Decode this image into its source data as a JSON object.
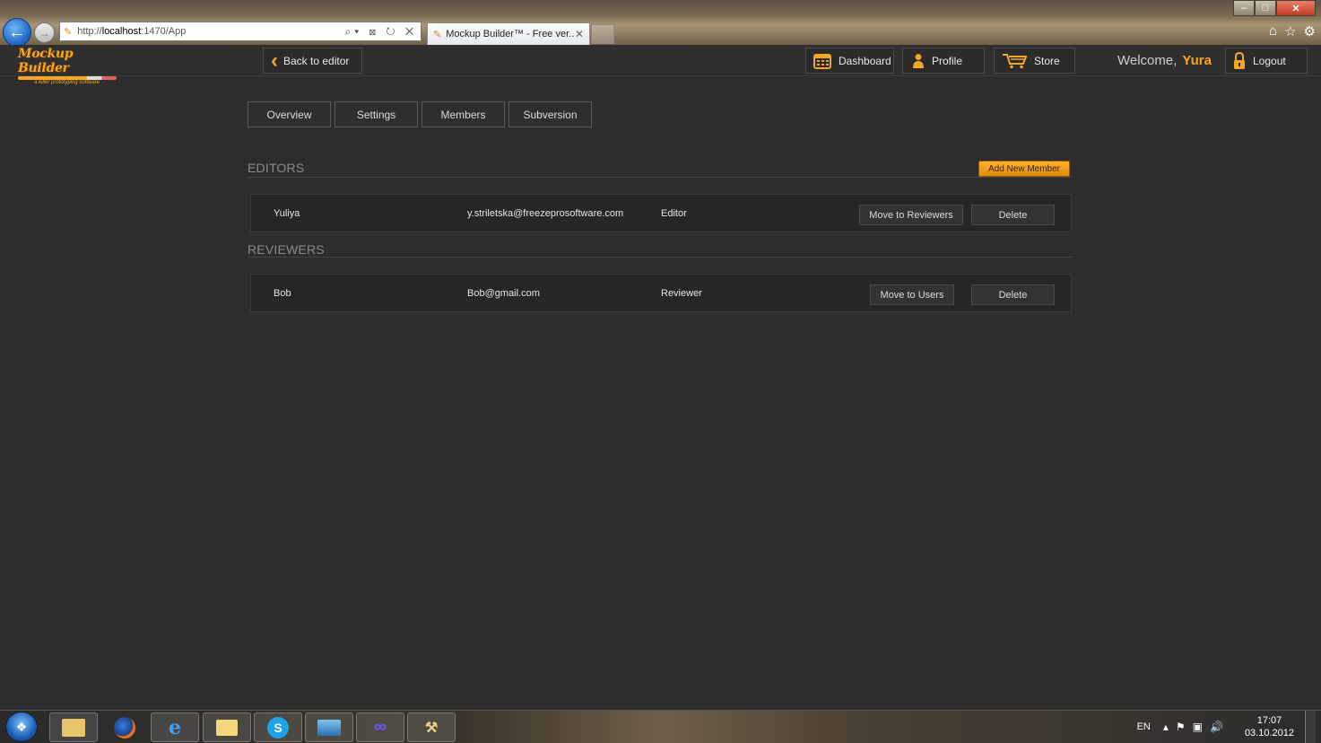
{
  "browser": {
    "url_prefix": "http://",
    "url_host": "localhost",
    "url_suffix": ":1470/App",
    "tab_title": "Mockup Builder™ - Free ver...",
    "address_tools": "⌕▾ ⊠ ↻ ✕"
  },
  "logo": {
    "name": "Mockup Builder",
    "tagline": "a killer prototyping software"
  },
  "header": {
    "back_label": "Back to editor",
    "dashboard_label": "Dashboard",
    "profile_label": "Profile",
    "store_label": "Store",
    "welcome_text": "Welcome,",
    "username": "Yura",
    "logout_label": "Logout"
  },
  "tabs": [
    {
      "label": "Overview"
    },
    {
      "label": "Settings"
    },
    {
      "label": "Members"
    },
    {
      "label": "Subversion"
    }
  ],
  "editors": {
    "title": "EDITORS",
    "add_button": "Add New Member",
    "members": [
      {
        "name": "Yuliya",
        "email": "y.striletska@freezeprosoftware.com",
        "role": "Editor",
        "move_label": "Move to Reviewers",
        "delete_label": "Delete"
      }
    ]
  },
  "reviewers": {
    "title": "REVIEWERS",
    "members": [
      {
        "name": "Bob",
        "email": "Bob@gmail.com",
        "role": "Reviewer",
        "move_label": "Move to Users",
        "delete_label": "Delete"
      }
    ]
  },
  "taskbar": {
    "language": "EN",
    "time": "17:07",
    "date": "03.10.2012",
    "apps": [
      "explorer-icon",
      "firefox-icon",
      "internet-explorer-icon",
      "folder-icon",
      "skype-icon",
      "photo-viewer-icon",
      "infinity-app-icon",
      "tools-icon"
    ]
  },
  "colors": {
    "accent": "#f5a623",
    "background": "#2d2d2d",
    "row_background": "#262626"
  }
}
